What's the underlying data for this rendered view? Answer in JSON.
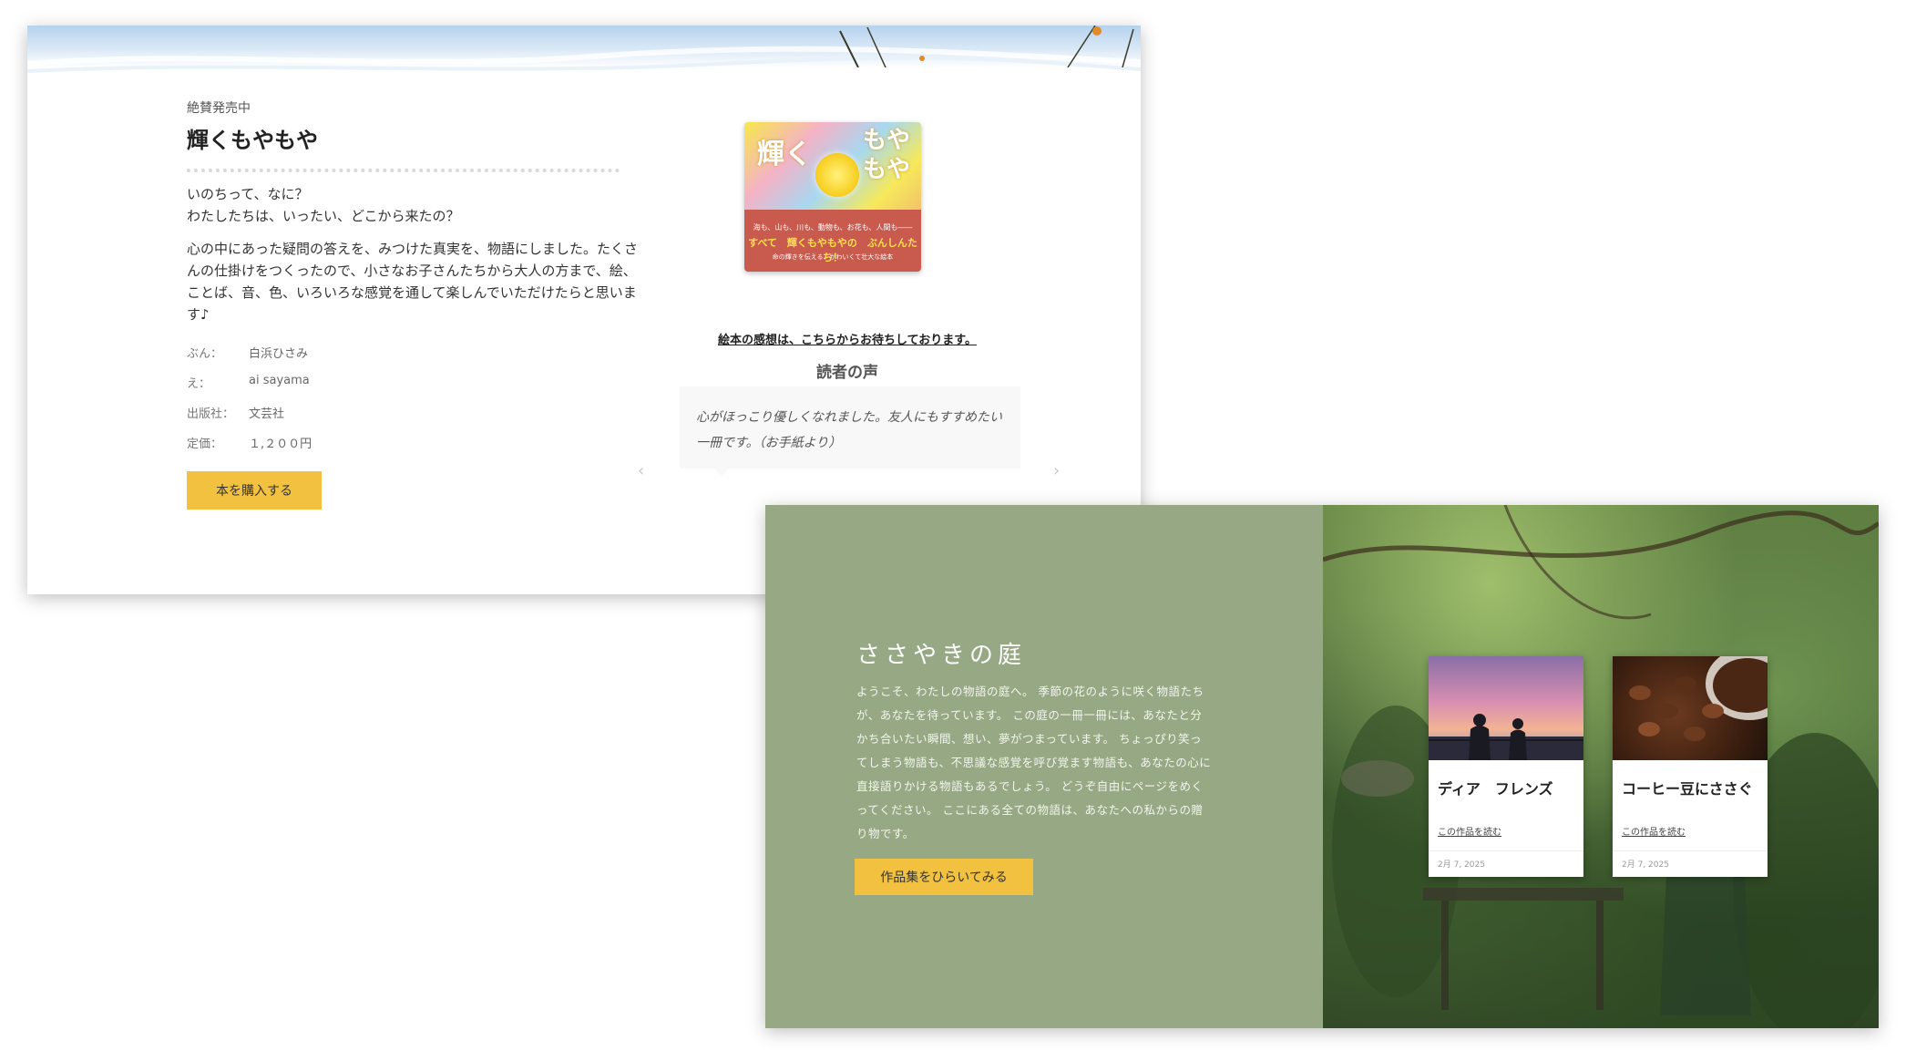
{
  "book": {
    "kicker": "絶賛発売中",
    "title": "輝くもやもや",
    "intro": "いのちって、なに？\nわたしたちは、いったい、どこから来たの？",
    "description": "心の中にあった疑問の答えを、みつけた真実を、物語にしました。たくさんの仕掛けをつくったので、小さなお子さんたちから大人の方まで、絵、ことば、音、色、いろいろな感覚を通して楽しんでいただけたらと思います♪",
    "info": [
      {
        "label": "ぶん：",
        "value": "白浜ひさみ"
      },
      {
        "label": "え：",
        "value": "ai sayama"
      },
      {
        "label": "出版社：",
        "value": "文芸社"
      },
      {
        "label": "定価：",
        "value": "１,２００円"
      }
    ],
    "buy_label": "本を購入する",
    "cover": {
      "title_a": "輝く",
      "title_b": "もや\nもや",
      "line1": "海も、山も、川も、動物も、お花も、人間も――",
      "line2": "すべて　輝くもやもやの　ぶんしんたち！",
      "line3": "命の輝きを伝える、かわいくて壮大な絵本"
    },
    "feedback_link": "絵本の感想は、こちらからお待ちしております。",
    "voices_title": "読者の声",
    "quote": "心がほっこり優しくなれました。友人にもすすめたい一冊です。（お手紙より）",
    "prev_icon": "‹",
    "next_icon": "›"
  },
  "garden": {
    "title": "ささやきの庭",
    "text": "ようこそ、わたしの物語の庭へ。 季節の花のように咲く物語たちが、あなたを待っています。 この庭の一冊一冊には、あなたと分かち合いたい瞬間、想い、夢がつまっています。 ちょっぴり笑ってしまう物語も、不思議な感覚を呼び覚ます物語も、あなたの心に直接語りかける物語もあるでしょう。 どうぞ自由にページをめくってください。 ここにある全ての物語は、あなたへの私からの贈り物です。",
    "button_label": "作品集をひらいてみる",
    "cards": [
      {
        "title": "ディア　フレンズ",
        "link": "この作品を読む",
        "date": "2月 7, 2025"
      },
      {
        "title": "コーヒー豆にささぐ",
        "link": "この作品を読む",
        "date": "2月 7, 2025"
      }
    ]
  },
  "colors": {
    "accent_yellow": "#f2c13f",
    "sage_green": "#96a984"
  }
}
